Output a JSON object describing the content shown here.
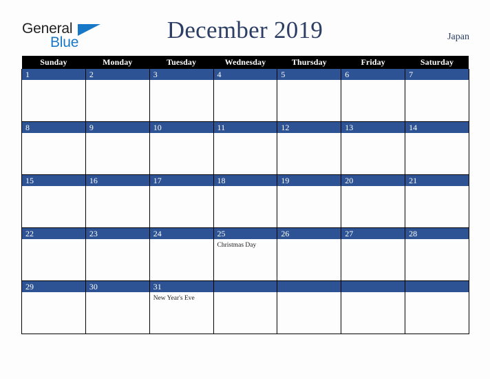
{
  "brand": {
    "line1": "General",
    "line2": "Blue",
    "triangle_icon": "triangle-icon",
    "color_dark": "#222222",
    "color_blue": "#1878c8"
  },
  "header": {
    "title": "December 2019",
    "country": "Japan",
    "title_color": "#2c3e63"
  },
  "calendar": {
    "weekdays": [
      "Sunday",
      "Monday",
      "Tuesday",
      "Wednesday",
      "Thursday",
      "Friday",
      "Saturday"
    ],
    "header_bg": "#000000",
    "daybar_bg": "#2e5394",
    "cell_bg": "#fdfdfd",
    "weeks": [
      [
        {
          "day": "1",
          "events": []
        },
        {
          "day": "2",
          "events": []
        },
        {
          "day": "3",
          "events": []
        },
        {
          "day": "4",
          "events": []
        },
        {
          "day": "5",
          "events": []
        },
        {
          "day": "6",
          "events": []
        },
        {
          "day": "7",
          "events": []
        }
      ],
      [
        {
          "day": "8",
          "events": []
        },
        {
          "day": "9",
          "events": []
        },
        {
          "day": "10",
          "events": []
        },
        {
          "day": "11",
          "events": []
        },
        {
          "day": "12",
          "events": []
        },
        {
          "day": "13",
          "events": []
        },
        {
          "day": "14",
          "events": []
        }
      ],
      [
        {
          "day": "15",
          "events": []
        },
        {
          "day": "16",
          "events": []
        },
        {
          "day": "17",
          "events": []
        },
        {
          "day": "18",
          "events": []
        },
        {
          "day": "19",
          "events": []
        },
        {
          "day": "20",
          "events": []
        },
        {
          "day": "21",
          "events": []
        }
      ],
      [
        {
          "day": "22",
          "events": []
        },
        {
          "day": "23",
          "events": []
        },
        {
          "day": "24",
          "events": []
        },
        {
          "day": "25",
          "events": [
            "Christmas Day"
          ]
        },
        {
          "day": "26",
          "events": []
        },
        {
          "day": "27",
          "events": []
        },
        {
          "day": "28",
          "events": []
        }
      ],
      [
        {
          "day": "29",
          "events": []
        },
        {
          "day": "30",
          "events": []
        },
        {
          "day": "31",
          "events": [
            "New Year's Eve"
          ]
        },
        {
          "day": "",
          "events": []
        },
        {
          "day": "",
          "events": []
        },
        {
          "day": "",
          "events": []
        },
        {
          "day": "",
          "events": []
        }
      ]
    ]
  }
}
